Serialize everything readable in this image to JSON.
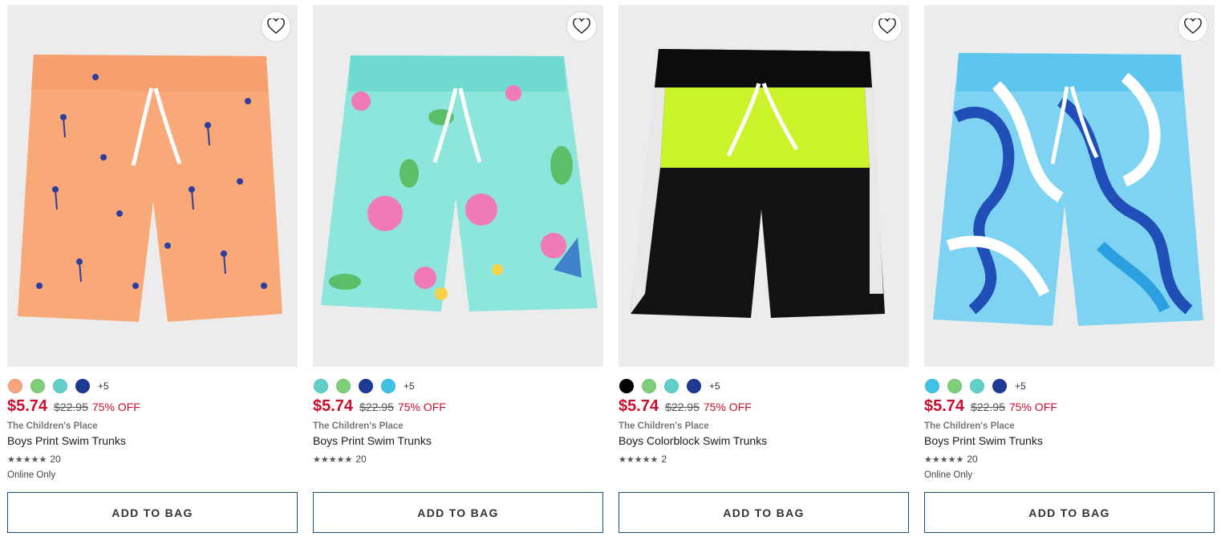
{
  "products": [
    {
      "swatches": [
        "#f7a37c",
        "#7fcf7a",
        "#5fd1c9",
        "#1f3a93"
      ],
      "more": "+5",
      "price": "$5.74",
      "orig": "$22.95",
      "off": "75% OFF",
      "brand": "The Children's Place",
      "name": "Boys Print Swim Trunks",
      "stars": "★★★★★",
      "rcount": "20",
      "online": "Online Only",
      "cta": "ADD TO BAG"
    },
    {
      "swatches": [
        "#5fd1c9",
        "#7fcf7a",
        "#1f3a93",
        "#3fc0e6"
      ],
      "more": "+5",
      "price": "$5.74",
      "orig": "$22.95",
      "off": "75% OFF",
      "brand": "The Children's Place",
      "name": "Boys Print Swim Trunks",
      "stars": "★★★★★",
      "rcount": "20",
      "online": "",
      "cta": "ADD TO BAG"
    },
    {
      "swatches": [
        "#000000",
        "#7fcf7a",
        "#5fd1c9",
        "#1f3a93"
      ],
      "more": "+5",
      "price": "$5.74",
      "orig": "$22.95",
      "off": "75% OFF",
      "brand": "The Children's Place",
      "name": "Boys Colorblock Swim Trunks",
      "stars": "★★★★★",
      "rcount": "2",
      "online": "",
      "cta": "ADD TO BAG"
    },
    {
      "swatches": [
        "#3fc0e6",
        "#7fcf7a",
        "#5fd1c9",
        "#1f3a93"
      ],
      "more": "+5",
      "price": "$5.74",
      "orig": "$22.95",
      "off": "75% OFF",
      "brand": "The Children's Place",
      "name": "Boys Print Swim Trunks",
      "stars": "★★★★★",
      "rcount": "20",
      "online": "Online Only",
      "cta": "ADD TO BAG"
    }
  ],
  "icons": {
    "favorite": "heart-outline-icon"
  },
  "colors": {
    "sale_red": "#c8102e",
    "button_border": "#1d4e6e",
    "image_bg": "#ececec"
  }
}
